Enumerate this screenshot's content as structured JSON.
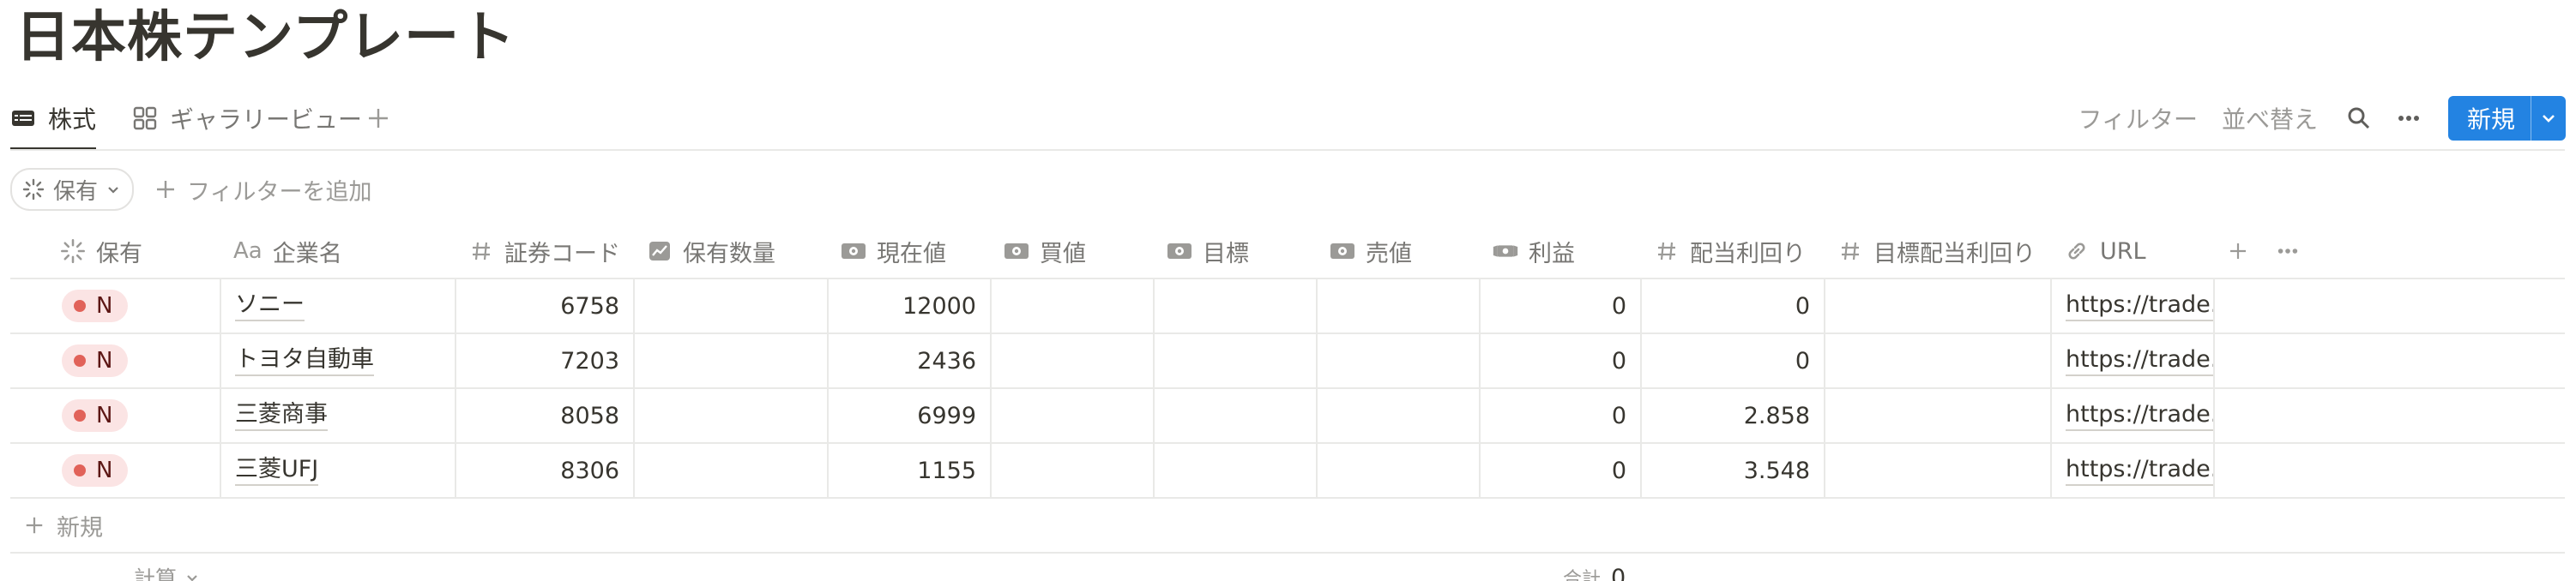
{
  "page": {
    "title": "日本株テンプレート"
  },
  "tabs": [
    {
      "label": "株式",
      "icon": "table-icon",
      "active": true
    },
    {
      "label": "ギャラリービュー",
      "icon": "gallery-icon",
      "active": false
    }
  ],
  "toolbar": {
    "filter_label": "フィルター",
    "sort_label": "並べ替え",
    "new_label": "新規"
  },
  "filter": {
    "chip_label": "保有",
    "add_filter_label": "フィルターを追加"
  },
  "columns": [
    {
      "label": "保有",
      "icon": "status-icon"
    },
    {
      "label": "企業名",
      "icon": "text-aa-icon",
      "prefix": "Aa"
    },
    {
      "label": "証券コード",
      "icon": "number-icon"
    },
    {
      "label": "保有数量",
      "icon": "chart-icon"
    },
    {
      "label": "現在値",
      "icon": "money-icon"
    },
    {
      "label": "買値",
      "icon": "money-icon"
    },
    {
      "label": "目標",
      "icon": "money-icon"
    },
    {
      "label": "売値",
      "icon": "money-icon"
    },
    {
      "label": "利益",
      "icon": "money-wings-icon"
    },
    {
      "label": "配当利回り",
      "icon": "number-icon"
    },
    {
      "label": "目標配当利回り",
      "icon": "number-icon"
    },
    {
      "label": "URL",
      "icon": "link-icon"
    }
  ],
  "rows": [
    {
      "status": "N",
      "name": "ソニー",
      "code": "6758",
      "qty": "",
      "price": "12000",
      "buy": "",
      "target": "",
      "sell": "",
      "profit": "0",
      "yield": "0",
      "target_yield": "",
      "url": "https://trade.lin"
    },
    {
      "status": "N",
      "name": "トヨタ自動車",
      "code": "7203",
      "qty": "",
      "price": "2436",
      "buy": "",
      "target": "",
      "sell": "",
      "profit": "0",
      "yield": "0",
      "target_yield": "",
      "url": "https://trade.lin"
    },
    {
      "status": "N",
      "name": "三菱商事",
      "code": "8058",
      "qty": "",
      "price": "6999",
      "buy": "",
      "target": "",
      "sell": "",
      "profit": "0",
      "yield": "2.858",
      "target_yield": "",
      "url": "https://trade.lin"
    },
    {
      "status": "N",
      "name": "三菱UFJ",
      "code": "8306",
      "qty": "",
      "price": "1155",
      "buy": "",
      "target": "",
      "sell": "",
      "profit": "0",
      "yield": "3.548",
      "target_yield": "",
      "url": "https://trade.lin"
    }
  ],
  "footer": {
    "new_row_label": "新規",
    "calc_label": "計算",
    "sum_label": "合計",
    "sum_value": "0"
  },
  "colors": {
    "accent": "#2383e2",
    "status_bg": "#fbe4e4",
    "status_dot": "#e16259",
    "text": "#37352f",
    "muted": "#787774"
  }
}
